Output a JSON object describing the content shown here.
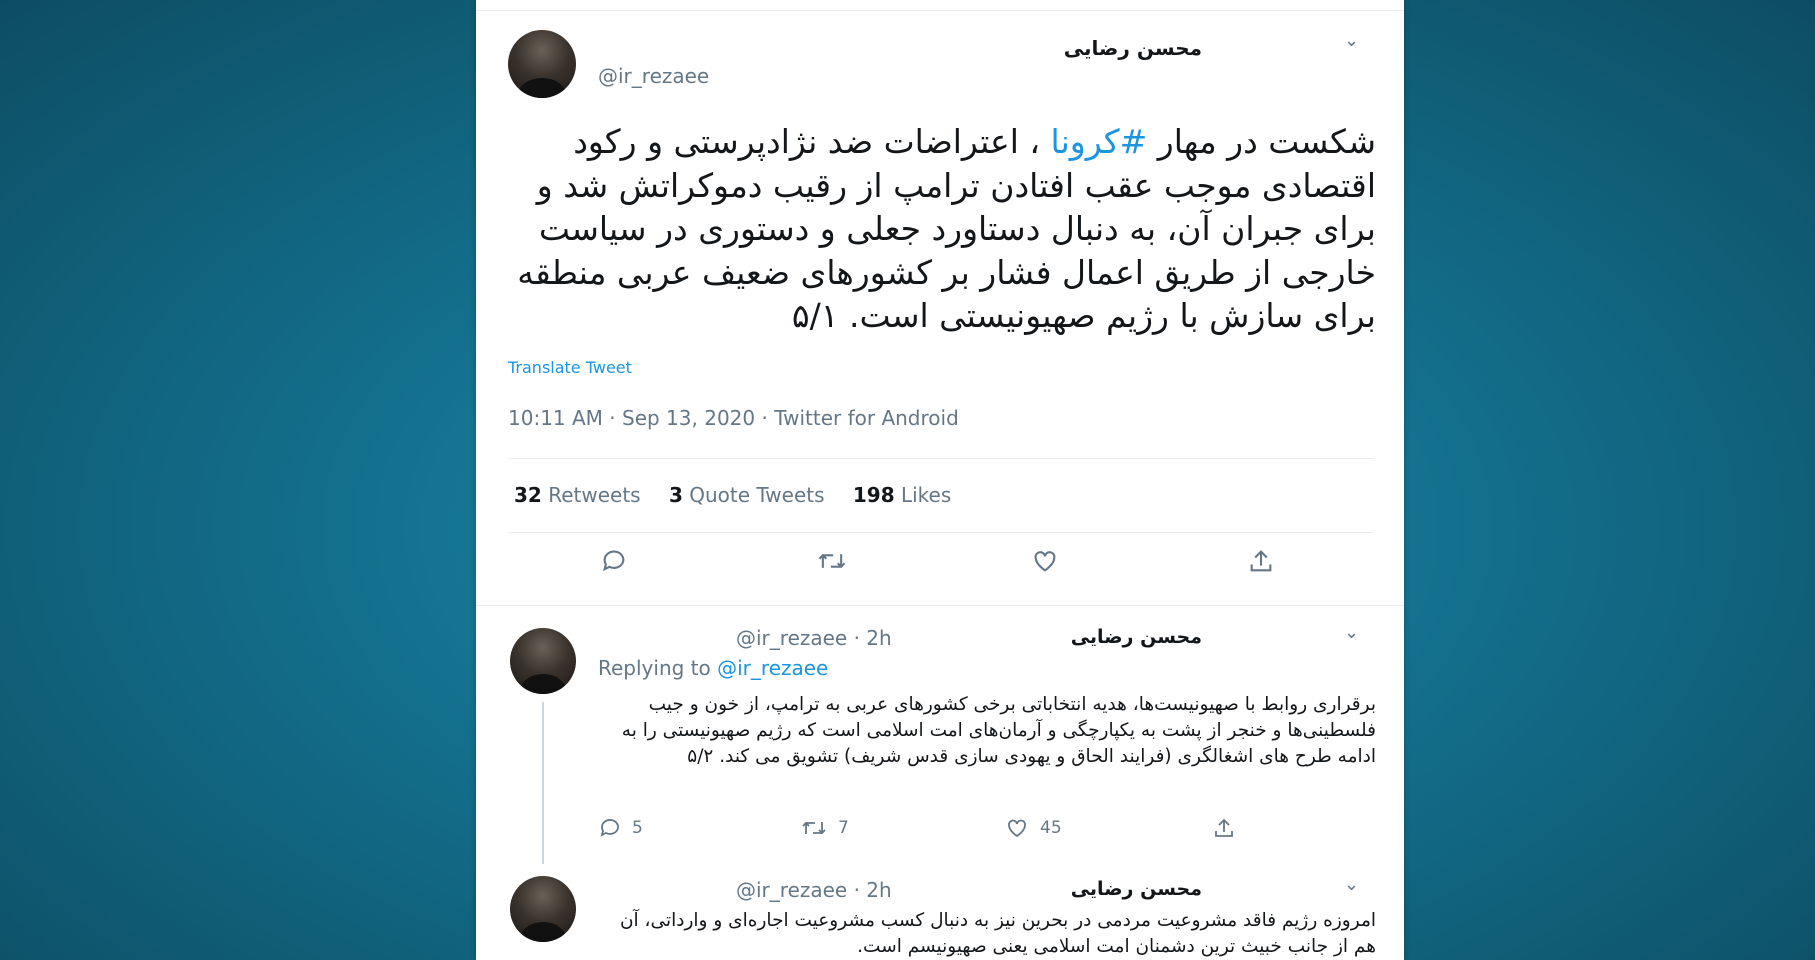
{
  "main_tweet": {
    "name": "محسن رضایی",
    "handle": "@ir_rezaee",
    "text_before_hashtag": "شکست در مهار ",
    "hashtag": "#کرونا",
    "text_after_hashtag": " ، اعتراضات ضد نژادپرستی و رکود اقتصادی موجب عقب افتادن ترامپ از رقیب دموکراتش شد و برای جبران آن، به دنبال دستاورد جعلی و دستوری در سیاست خارجی از طریق اعمال فشار بر کشورهای ضعیف عربی منطقه برای سازش با رژیم صهیونیستی است. ۵/۱",
    "translate_label": "Translate Tweet",
    "meta": "10:11 AM · Sep 13, 2020 · Twitter for Android",
    "stats": {
      "retweets_count": "32",
      "retweets_label": "Retweets",
      "quotes_count": "3",
      "quotes_label": "Quote Tweets",
      "likes_count": "198",
      "likes_label": "Likes"
    }
  },
  "replies": [
    {
      "name": "محسن رضایی",
      "handle_time": "@ir_rezaee · 2h",
      "replying_prefix": "Replying to ",
      "replying_handle": "@ir_rezaee",
      "text": "برقراری روابط با صهیونیست‌ها، هدیه انتخاباتی برخی کشورهای عربی به ترامپ، از خون و جیب فلسطینی‌ها و خنجر از پشت به یکپارچگی و آرمان‌های امت اسلامی است که رژیم صهیونیستی را به ادامه طرح های اشغالگری (فرایند الحاق و یهودی سازی قدس شریف) تشویق می کند. ۵/۲",
      "reply_count": "5",
      "retweet_count": "7",
      "like_count": "45"
    },
    {
      "name": "محسن رضایی",
      "handle_time": "@ir_rezaee · 2h",
      "text": "امروزه رژیم فاقد مشروعیت مردمی در بحرین نیز به دنبال کسب مشروعیت اجاره‌ای و وارداتی، آن هم از جانب خبیث ترین دشمنان امت اسلامی یعنی صهیونیسم است."
    }
  ],
  "icons": {
    "reply": "speech-bubble-icon",
    "retweet": "retweet-arrows-icon",
    "like": "heart-icon",
    "share": "share-upload-icon",
    "menu": "chevron-down-icon"
  },
  "colors": {
    "background": "#136f8c",
    "link": "#1b95e0",
    "text": "#14171a",
    "muted": "#657786"
  }
}
